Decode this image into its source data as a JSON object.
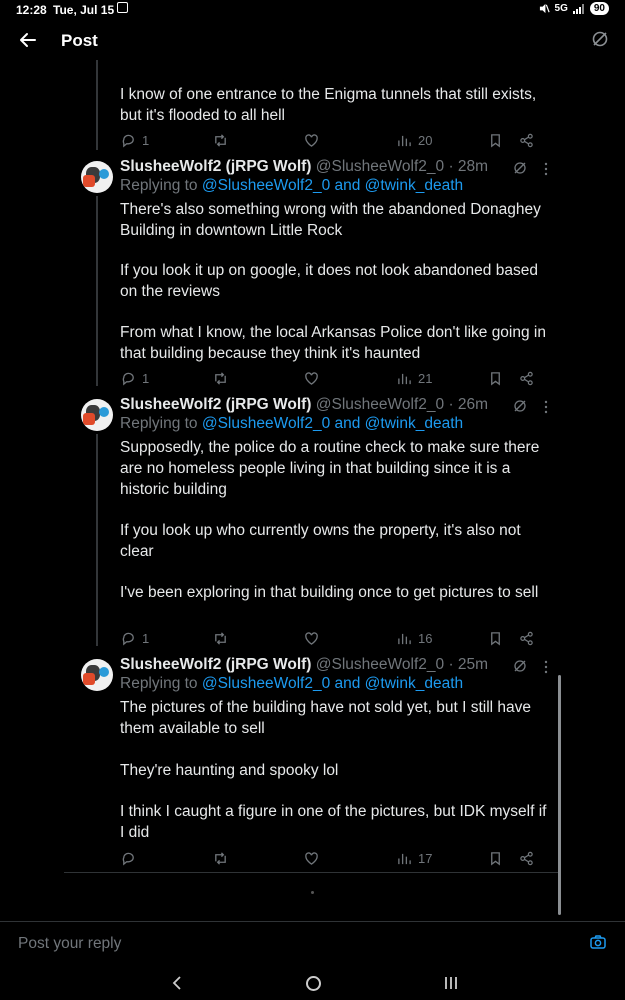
{
  "status_bar": {
    "time": "12:28",
    "date": "Tue, Jul 15",
    "network": "5G",
    "battery": "90"
  },
  "header": {
    "title": "Post"
  },
  "partial_tweet": {
    "paragraphs": [
      "I know of one entrance to the Enigma tunnels that still exists, but it's flooded to all hell"
    ],
    "replies": "1",
    "views": "20"
  },
  "tweets": [
    {
      "name": "SlusheeWolf2 (jRPG Wolf)",
      "handle": "@SlusheeWolf2_0",
      "time": "· 28m",
      "replying_prefix": "Replying to ",
      "replying_to": "@SlusheeWolf2_0 and @twink_death",
      "paragraphs": [
        "There's also something wrong with the abandoned Donaghey Building in downtown Little Rock",
        "If you look it up on google, it does not look abandoned based on the reviews",
        "From what I know, the local Arkansas Police don't like going in that building because they think it's haunted"
      ],
      "replies": "1",
      "views": "21"
    },
    {
      "name": "SlusheeWolf2 (jRPG Wolf)",
      "handle": "@SlusheeWolf2_0",
      "time": "· 26m",
      "replying_prefix": "Replying to ",
      "replying_to": "@SlusheeWolf2_0 and @twink_death",
      "paragraphs": [
        "Supposedly, the police do a routine check to make sure there are no homeless people living in that building since it is a historic building",
        "If you look up who currently owns the property, it's also not clear",
        "I've been exploring in that building once to get pictures to sell"
      ],
      "replies": "1",
      "views": "16"
    },
    {
      "name": "SlusheeWolf2 (jRPG Wolf)",
      "handle": "@SlusheeWolf2_0",
      "time": "· 25m",
      "replying_prefix": "Replying to ",
      "replying_to": "@SlusheeWolf2_0 and @twink_death",
      "paragraphs": [
        "The pictures of the building have not sold yet, but I still have them available to sell",
        "They're haunting and spooky lol",
        "I think I caught a figure in one of the pictures, but IDK myself if I did"
      ],
      "replies": "",
      "views": "17"
    }
  ],
  "reply_bar": {
    "placeholder": "Post your reply"
  },
  "icons": [
    "back-arrow-icon",
    "refresh-icon",
    "reply-icon",
    "retweet-icon",
    "like-icon",
    "views-icon",
    "bookmark-icon",
    "share-icon",
    "grok-icon",
    "more-icon",
    "camera-icon"
  ],
  "colors": {
    "background": "#000000",
    "text": "#e7e9ea",
    "muted": "#71767b",
    "accent": "#1d9bf0"
  }
}
